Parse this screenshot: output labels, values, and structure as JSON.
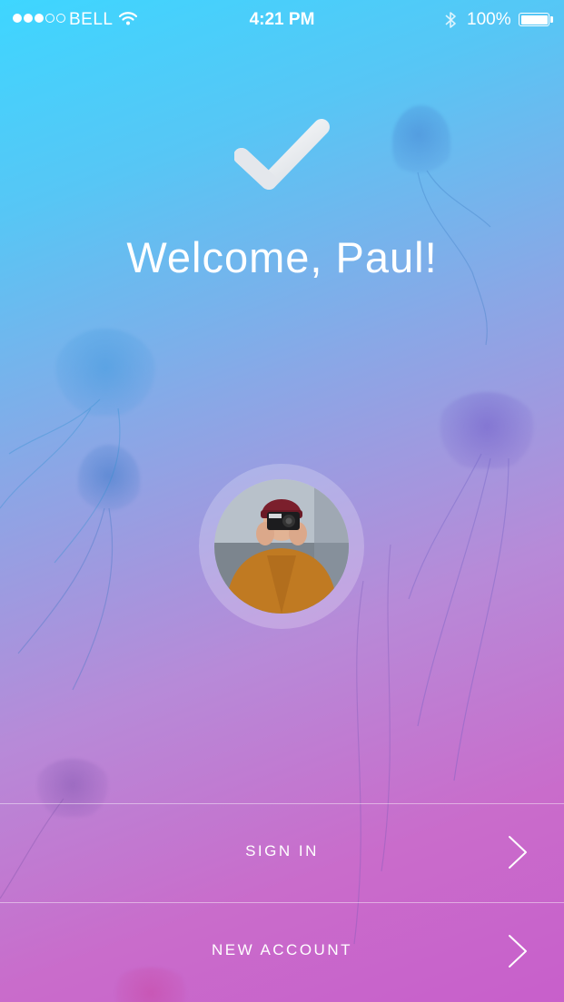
{
  "status_bar": {
    "carrier": "BELL",
    "time": "4:21 PM",
    "battery": "100%",
    "signal_bars_filled": 3,
    "signal_bars_total": 5
  },
  "welcome": {
    "title": "Welcome, Paul!"
  },
  "icons": {
    "check": "checkmark-icon",
    "wifi": "wifi-icon",
    "bluetooth": "bluetooth-icon",
    "battery": "battery-icon",
    "chevron": "chevron-right-icon"
  },
  "actions": {
    "sign_in": "SIGN IN",
    "new_account": "NEW ACCOUNT"
  },
  "colors": {
    "gradient_top": "#3ED6FF",
    "gradient_bottom": "#C85FCB",
    "text": "#FFFFFF"
  }
}
